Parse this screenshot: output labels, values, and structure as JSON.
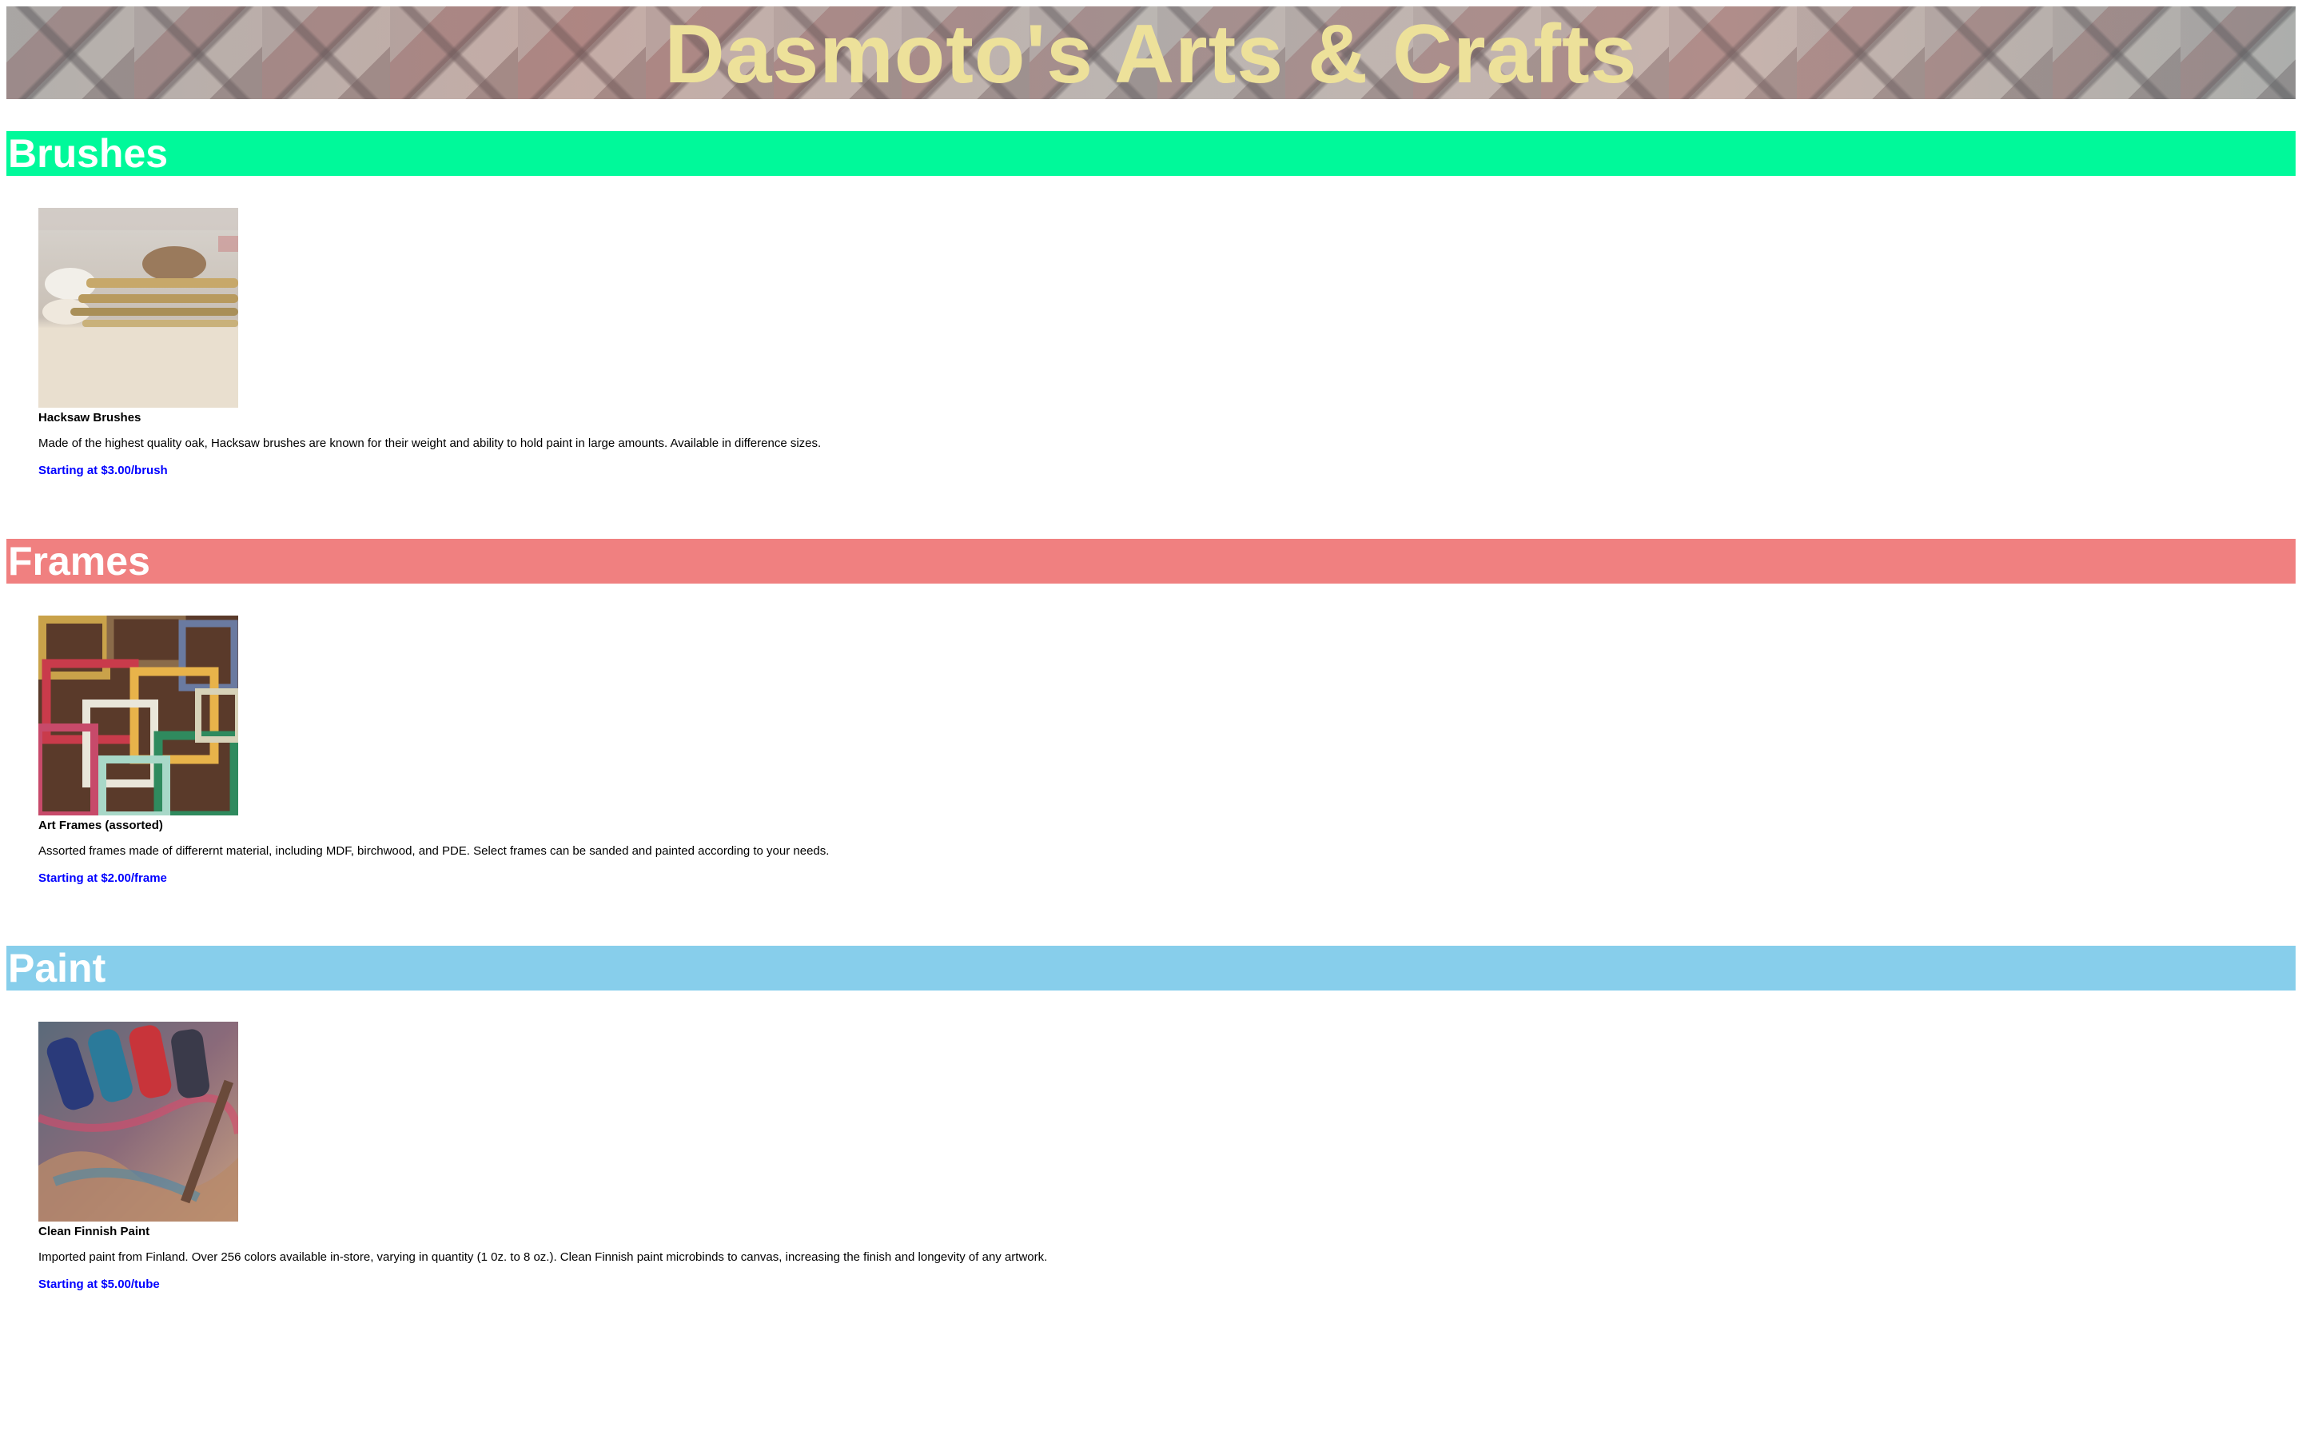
{
  "header": {
    "title": "Dasmoto's Arts & Crafts"
  },
  "sections": [
    {
      "heading": "Brushes",
      "color": "#00f99a",
      "product": {
        "image": "paintbrushes-photo",
        "name": "Hacksaw Brushes",
        "description": "Made of the highest quality oak, Hacksaw brushes are known for their weight and ability to hold paint in large amounts. Available in difference sizes.",
        "price": "Starting at $3.00/brush"
      }
    },
    {
      "heading": "Frames",
      "color": "#f08080",
      "product": {
        "image": "art-frames-photo",
        "name": "Art Frames (assorted)",
        "description": "Assorted frames made of differernt material, including MDF, birchwood, and PDE. Select frames can be sanded and painted according to your needs.",
        "price": "Starting at $2.00/frame"
      }
    },
    {
      "heading": "Paint",
      "color": "#87ceeb",
      "product": {
        "image": "paint-tubes-photo",
        "name": "Clean Finnish Paint",
        "description": "Imported paint from Finland. Over 256 colors available in-store, varying in quantity (1 0z. to 8 oz.). Clean Finnish paint microbinds to canvas, increasing the finish and longevity of any artwork.",
        "price": "Starting at $5.00/tube"
      }
    }
  ],
  "colors": {
    "title_text": "#ede19a",
    "heading_text": "#ffffff",
    "price_text": "#0000ff"
  }
}
